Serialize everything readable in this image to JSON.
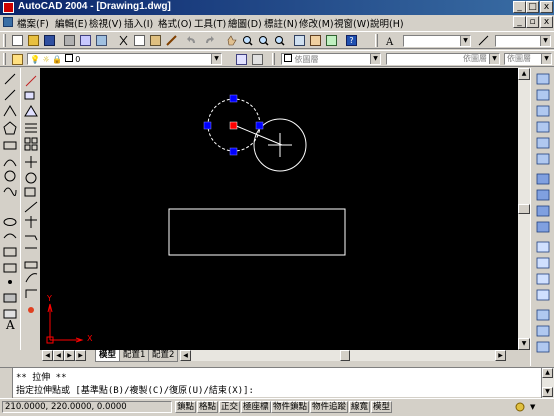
{
  "window": {
    "title": "AutoCAD 2004 - [Drawing1.dwg]",
    "minimize_glyph": "_",
    "maximize_glyph": "□",
    "close_glyph": "x"
  },
  "menu": {
    "items": [
      "檔案(F)",
      "編輯(E)",
      "檢視(V)",
      "插入(I)",
      "格式(O)",
      "工具(T)",
      "繪圖(D)",
      "標註(N)",
      "修改(M)",
      "視窗(W)",
      "說明(H)"
    ]
  },
  "properties_bar": {
    "layer_value": "0",
    "color_value": "依圖層",
    "linetype_value": "依圖層",
    "lineweight_value": "依圖層",
    "plotstyle_value": "依顏色"
  },
  "layout_tabs": [
    "模型",
    "配置1",
    "配置2"
  ],
  "command": {
    "line1": "** 拉伸 **",
    "line2": "指定拉伸點或 [基準點(B)/複製(C)/復原(U)/結束(X)]:"
  },
  "status": {
    "coordinates": "210.0000, 220.0000, 0.0000",
    "toggles": [
      "鎖點",
      "格點",
      "正交",
      "極座標",
      "物件鎖點",
      "物件追蹤",
      "線寬",
      "模型"
    ]
  },
  "ucs": {
    "x_label": "X",
    "y_label": "Y"
  },
  "colors": {
    "canvas": "#000000",
    "title_start": "#0a246a",
    "title_end": "#3a6ea5",
    "grip_selected": "#ff0000",
    "grip_unselected": "#0000ff",
    "ucs": "#ff0000"
  }
}
